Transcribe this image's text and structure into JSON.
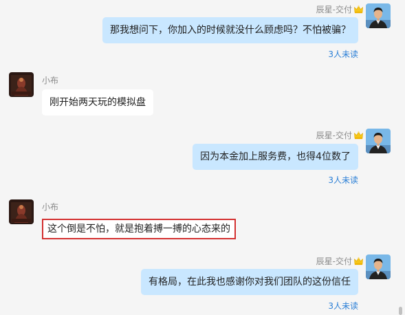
{
  "messages": [
    {
      "direction": "out",
      "sender": "辰星-交付",
      "text": "那我想问下，你加入的时候就没什么顾虑吗？不怕被骗？",
      "read_status": "3人未读"
    },
    {
      "direction": "in",
      "sender": "小布",
      "text": "刚开始两天玩的模拟盘"
    },
    {
      "direction": "out",
      "sender": "辰星-交付",
      "text": "因为本金加上服务费，也得4位数了",
      "read_status": "3人未读"
    },
    {
      "direction": "in",
      "sender": "小布",
      "text": "这个倒是不怕，就是抱着搏一搏的心态来的",
      "highlighted": true
    },
    {
      "direction": "out",
      "sender": "辰星-交付",
      "text": "有格局，在此我也感谢你对我们团队的这份信任",
      "read_status": "3人未读"
    }
  ],
  "icons": {
    "verified_badge": "crown-badge-icon",
    "user_avatar": "avatar-man-blue-bg",
    "contact_avatar": "avatar-dark-figure"
  },
  "colors": {
    "outgoing_bubble": "#c9e7ff",
    "incoming_bubble": "#ffffff",
    "read_status": "#2b7fd6",
    "highlight_border": "#d32f2f",
    "background": "#f5f5f5"
  }
}
